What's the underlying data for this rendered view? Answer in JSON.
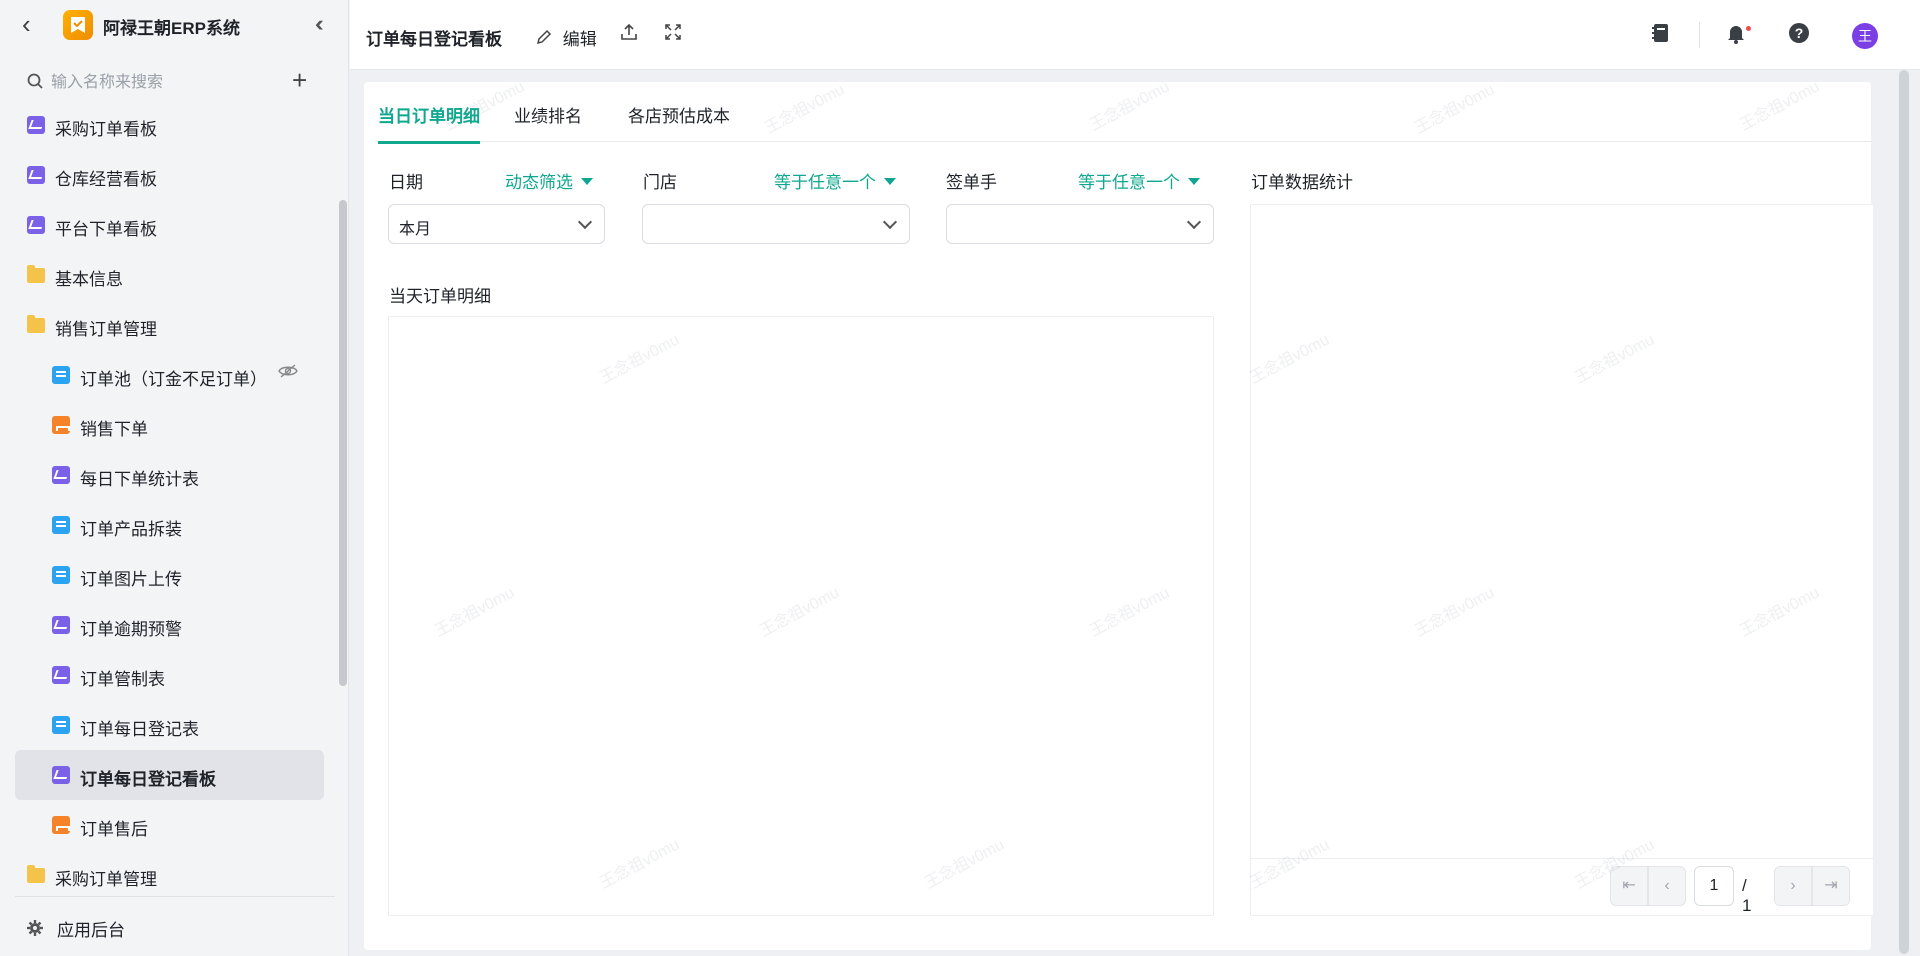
{
  "app": {
    "title": "阿禄王朝ERP系统"
  },
  "search": {
    "placeholder": "输入名称来搜索"
  },
  "sidebar": {
    "items": [
      {
        "label": "采购订单看板",
        "icon": "chart-icon",
        "level": 0
      },
      {
        "label": "仓库经营看板",
        "icon": "chart-icon",
        "level": 0
      },
      {
        "label": "平台下单看板",
        "icon": "chart-icon",
        "level": 0
      },
      {
        "label": "基本信息",
        "icon": "folder-icon",
        "level": 0
      },
      {
        "label": "销售订单管理",
        "icon": "folder-open-icon",
        "level": 0
      },
      {
        "label": "订单池（订金不足订单）",
        "icon": "form-icon",
        "level": 1,
        "hidden_icon": "eye-off-icon"
      },
      {
        "label": "销售下单",
        "icon": "org-icon",
        "level": 1
      },
      {
        "label": "每日下单统计表",
        "icon": "chart-icon",
        "level": 1
      },
      {
        "label": "订单产品拆装",
        "icon": "doc-icon",
        "level": 1
      },
      {
        "label": "订单图片上传",
        "icon": "doc-icon",
        "level": 1
      },
      {
        "label": "订单逾期预警",
        "icon": "chart-icon",
        "level": 1
      },
      {
        "label": "订单管制表",
        "icon": "chart-icon",
        "level": 1
      },
      {
        "label": "订单每日登记表",
        "icon": "doc-icon",
        "level": 1
      },
      {
        "label": "订单每日登记看板",
        "icon": "chart-icon",
        "level": 1,
        "active": true
      },
      {
        "label": "订单售后",
        "icon": "org-icon",
        "level": 1
      },
      {
        "label": "采购订单管理",
        "icon": "folder-icon",
        "level": 0
      }
    ],
    "footer_label": "应用后台"
  },
  "topbar": {
    "title": "订单每日登记看板",
    "edit_label": "编辑",
    "avatar_text": "王"
  },
  "tabs": [
    {
      "label": "当日订单明细",
      "active": true
    },
    {
      "label": "业绩排名",
      "active": false
    },
    {
      "label": "各店预估成本",
      "active": false
    }
  ],
  "filters": [
    {
      "label": "日期",
      "mode": "动态筛选",
      "value": "本月"
    },
    {
      "label": "门店",
      "mode": "等于任意一个",
      "value": ""
    },
    {
      "label": "签单手",
      "mode": "等于任意一个",
      "value": ""
    }
  ],
  "sections": {
    "detail_title": "当天订单明细",
    "stats_title": "订单数据统计"
  },
  "pager": {
    "page": "1",
    "total": "/ 1"
  },
  "watermark": "王念祖v0mu"
}
